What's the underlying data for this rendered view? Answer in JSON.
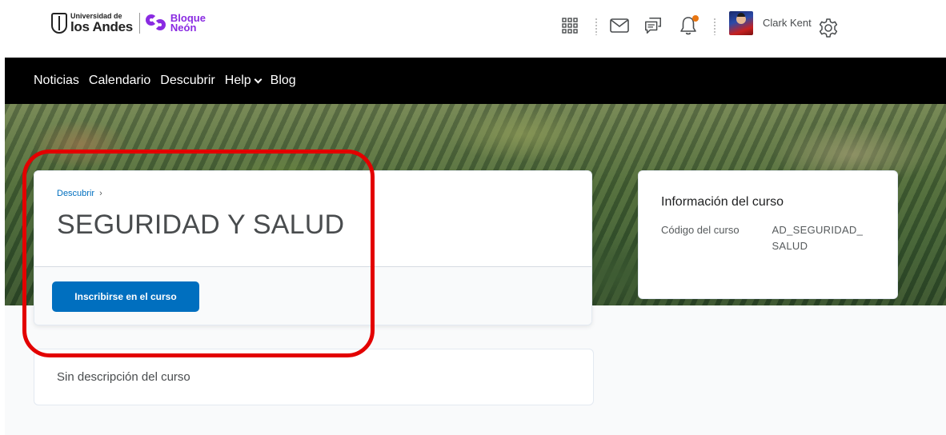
{
  "header": {
    "logo_universidad_small": "Universidad de",
    "logo_universidad_big": "los Andes",
    "logo_bloque": "Bloque",
    "logo_neon": "Neón",
    "user_name": "Clark Kent",
    "icons": [
      "waffle-icon",
      "mail-icon",
      "chat-icon",
      "bell-icon",
      "gear-icon"
    ],
    "notification_dot_color": "#e87511"
  },
  "navbar": {
    "items": [
      "Noticias",
      "Calendario",
      "Descubrir",
      "Help",
      "Blog"
    ]
  },
  "course": {
    "breadcrumb": "Descubrir",
    "breadcrumb_sep": "›",
    "title": "SEGURIDAD Y SALUD",
    "enroll_label": "Inscribirse en el curso",
    "accent_color": "#006fbf"
  },
  "info": {
    "title": "Información del curso",
    "code_label": "Código del curso",
    "code_value_line1": "AD_SEGURIDAD_",
    "code_value_line2": "SALUD"
  },
  "description": {
    "text": "Sin descripción del curso"
  },
  "annotation_color": "#e30000"
}
